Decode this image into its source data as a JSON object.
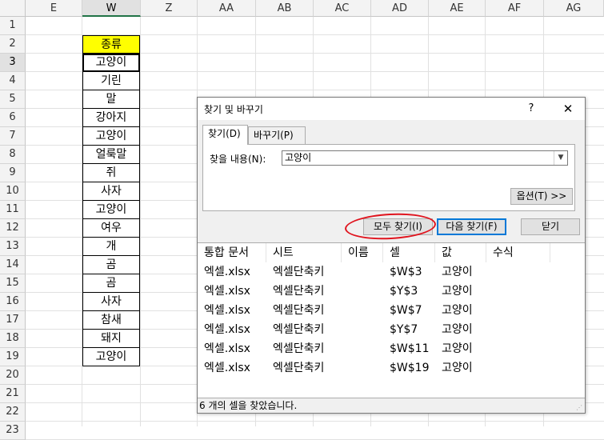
{
  "columns": [
    "E",
    "W",
    "Z",
    "AA",
    "AB",
    "AC",
    "AD",
    "AE",
    "AF",
    "AG"
  ],
  "rows": [
    "1",
    "2",
    "3",
    "4",
    "5",
    "6",
    "7",
    "8",
    "9",
    "10",
    "11",
    "12",
    "13",
    "14",
    "15",
    "16",
    "17",
    "18",
    "19",
    "20",
    "21",
    "22",
    "23"
  ],
  "w_column": {
    "header": "종류",
    "values": [
      "고양이",
      "기린",
      "말",
      "강아지",
      "고양이",
      "얼룩말",
      "쥐",
      "사자",
      "고양이",
      "여우",
      "개",
      "곰",
      "곰",
      "사자",
      "참새",
      "돼지",
      "고양이"
    ]
  },
  "dialog": {
    "title": "찾기 및 바꾸기",
    "help": "?",
    "close": "✕",
    "tabs": [
      "찾기(D)",
      "바꾸기(P)"
    ],
    "find_label": "찾을 내용(N):",
    "find_value": "고양이",
    "options_button": "옵션(T) >>",
    "find_all_button": "모두 찾기(I)",
    "find_next_button": "다음 찾기(F)",
    "close_button": "닫기",
    "results_headers": [
      "통합 문서",
      "시트",
      "이름",
      "셀",
      "값",
      "수식"
    ],
    "results": [
      [
        "엑셀.xlsx",
        "엑셀단축키",
        "",
        "$W$3",
        "고양이",
        ""
      ],
      [
        "엑셀.xlsx",
        "엑셀단축키",
        "",
        "$Y$3",
        "고양이",
        ""
      ],
      [
        "엑셀.xlsx",
        "엑셀단축키",
        "",
        "$W$7",
        "고양이",
        ""
      ],
      [
        "엑셀.xlsx",
        "엑셀단축키",
        "",
        "$Y$7",
        "고양이",
        ""
      ],
      [
        "엑셀.xlsx",
        "엑셀단축키",
        "",
        "$W$11",
        "고양이",
        ""
      ],
      [
        "엑셀.xlsx",
        "엑셀단축키",
        "",
        "$W$19",
        "고양이",
        ""
      ]
    ],
    "status": "6 개의 셀을 찾았습니다."
  },
  "colors": {
    "header_fill": "#ffff00",
    "annotation": "#e0141e",
    "focus": "#0078d7"
  }
}
